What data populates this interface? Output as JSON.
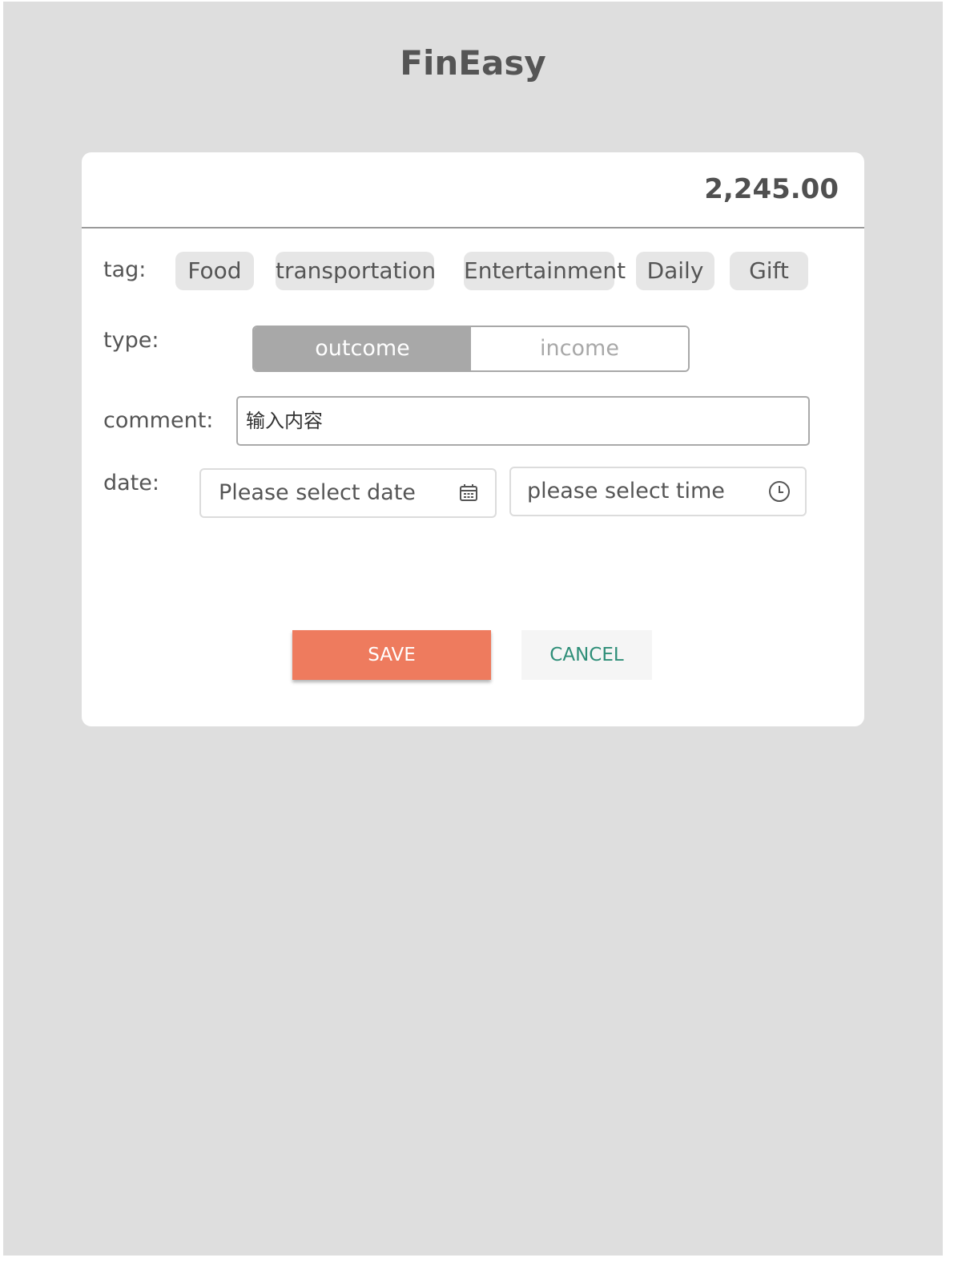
{
  "app": {
    "title": "FinEasy"
  },
  "amount": "2,245.00",
  "tag": {
    "label": "tag:",
    "items": [
      "Food",
      "transportation",
      "Entertainment",
      "Daily",
      "Gift"
    ]
  },
  "type": {
    "label": "type:",
    "options": [
      "outcome",
      "income"
    ],
    "selected": "outcome"
  },
  "comment": {
    "label": "comment:",
    "placeholder": "输入内容",
    "value": ""
  },
  "date": {
    "label": "date:",
    "date_placeholder": "Please select date",
    "time_placeholder": "please select time",
    "date_icon": "calendar-icon",
    "time_icon": "clock-icon"
  },
  "actions": {
    "save_label": "SAVE",
    "cancel_label": "CANCEL"
  },
  "colors": {
    "background": "#dedede",
    "save": "#ee7b5e",
    "cancel_text": "#2e8e78",
    "segment_active": "#a8a8a8"
  }
}
